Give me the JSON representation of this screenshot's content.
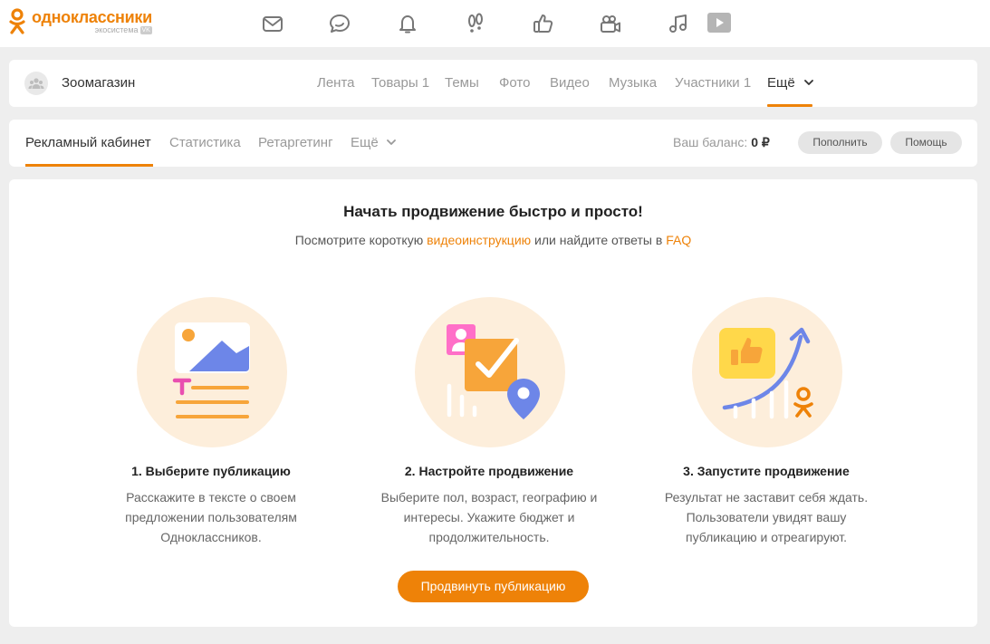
{
  "brand": {
    "name": "одноклассники",
    "sub": "экосистема",
    "vk": "VK",
    "accent": "#ee8208"
  },
  "topnav_icons": [
    "mail-icon",
    "chat-icon",
    "bell-icon",
    "footprints-icon",
    "like-icon",
    "video-camera-icon",
    "music-icon",
    "play-icon"
  ],
  "group": {
    "name": "Зоомагазин",
    "nav": [
      {
        "label": "Лента"
      },
      {
        "label": "Товары 1"
      },
      {
        "label": "Темы"
      },
      {
        "label": "Фото"
      },
      {
        "label": "Видео"
      },
      {
        "label": "Музыка"
      },
      {
        "label": "Участники 1"
      },
      {
        "label": "Ещё"
      }
    ]
  },
  "ads": {
    "tabs": [
      {
        "label": "Рекламный кабинет"
      },
      {
        "label": "Статистика"
      },
      {
        "label": "Ретаргетинг"
      },
      {
        "label": "Ещё"
      }
    ],
    "balance_label": "Ваш баланс:",
    "balance_value": "0 ₽",
    "topup": "Пополнить",
    "help": "Помощь"
  },
  "promo": {
    "headline": "Начать продвижение быстро и просто!",
    "sub_before": "Посмотрите короткую",
    "sub_link1": "видеоинструкцию",
    "sub_middle": "или найдите ответы в",
    "sub_link2": "FAQ",
    "steps": [
      {
        "title": "1. Выберите публикацию",
        "lines": [
          "Расскажите в тексте о своем",
          "предложении пользователям",
          "Одноклассников."
        ]
      },
      {
        "title": "2. Настройте продвижение",
        "lines": [
          "Выберите пол, возраст, географию и",
          "интересы. Укажите бюджет и",
          "продолжительность."
        ]
      },
      {
        "title": "3. Запустите продвижение",
        "lines": [
          "Результат не заставит себя ждать.",
          "Пользователи увидят вашу",
          "публикацию и отреагируют."
        ]
      }
    ],
    "cta": "Продвинуть публикацию"
  }
}
